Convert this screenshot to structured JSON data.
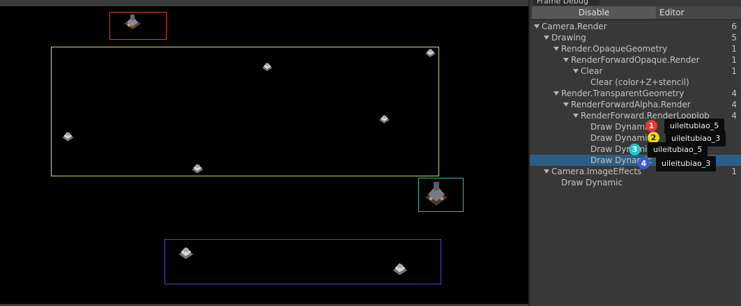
{
  "game_view": {
    "bounds": [
      {
        "name": "red-bounds",
        "color": "#e03a3a"
      },
      {
        "name": "yellow-bounds",
        "color": "#d8d86a"
      },
      {
        "name": "cyan-bounds",
        "color": "#3fb4b4"
      },
      {
        "name": "blue-bounds",
        "color": "#4a4ad8"
      }
    ]
  },
  "panel": {
    "tab_title": "Frame Debug",
    "disable_label": "Disable",
    "editor_label": "Editor"
  },
  "tree": [
    {
      "label": "Camera.Render",
      "count": "6"
    },
    {
      "label": "Drawing",
      "count": "5"
    },
    {
      "label": "Render.OpaqueGeometry",
      "count": "1"
    },
    {
      "label": "RenderForwardOpaque.Render",
      "count": "1"
    },
    {
      "label": "Clear",
      "count": "1"
    },
    {
      "label": "Clear (color+Z+stencil)",
      "count": ""
    },
    {
      "label": "Render.TransparentGeometry",
      "count": "4"
    },
    {
      "label": "RenderForwardAlpha.Render",
      "count": "4"
    },
    {
      "label": "RenderForward.RenderLoopJob",
      "count": "4"
    },
    {
      "label": "Draw Dynamic",
      "count": ""
    },
    {
      "label": "Draw Dynamic",
      "count": ""
    },
    {
      "label": "Draw Dynamic",
      "count": ""
    },
    {
      "label": "Draw Dynamic",
      "count": ""
    },
    {
      "label": "Camera.ImageEffects",
      "count": "1"
    },
    {
      "label": "Draw Dynamic",
      "count": ""
    }
  ],
  "markers": [
    {
      "number": "1",
      "color": "#e8333a",
      "tooltip": "uileitubiao_5"
    },
    {
      "number": "2",
      "color": "#e6d81a",
      "tooltip": "uileitubiao_3"
    },
    {
      "number": "3",
      "color": "#22c6c6",
      "tooltip": "uileitubiao_5"
    },
    {
      "number": "4",
      "color": "#3c5ad8",
      "tooltip": "uileitubiao_3"
    }
  ]
}
